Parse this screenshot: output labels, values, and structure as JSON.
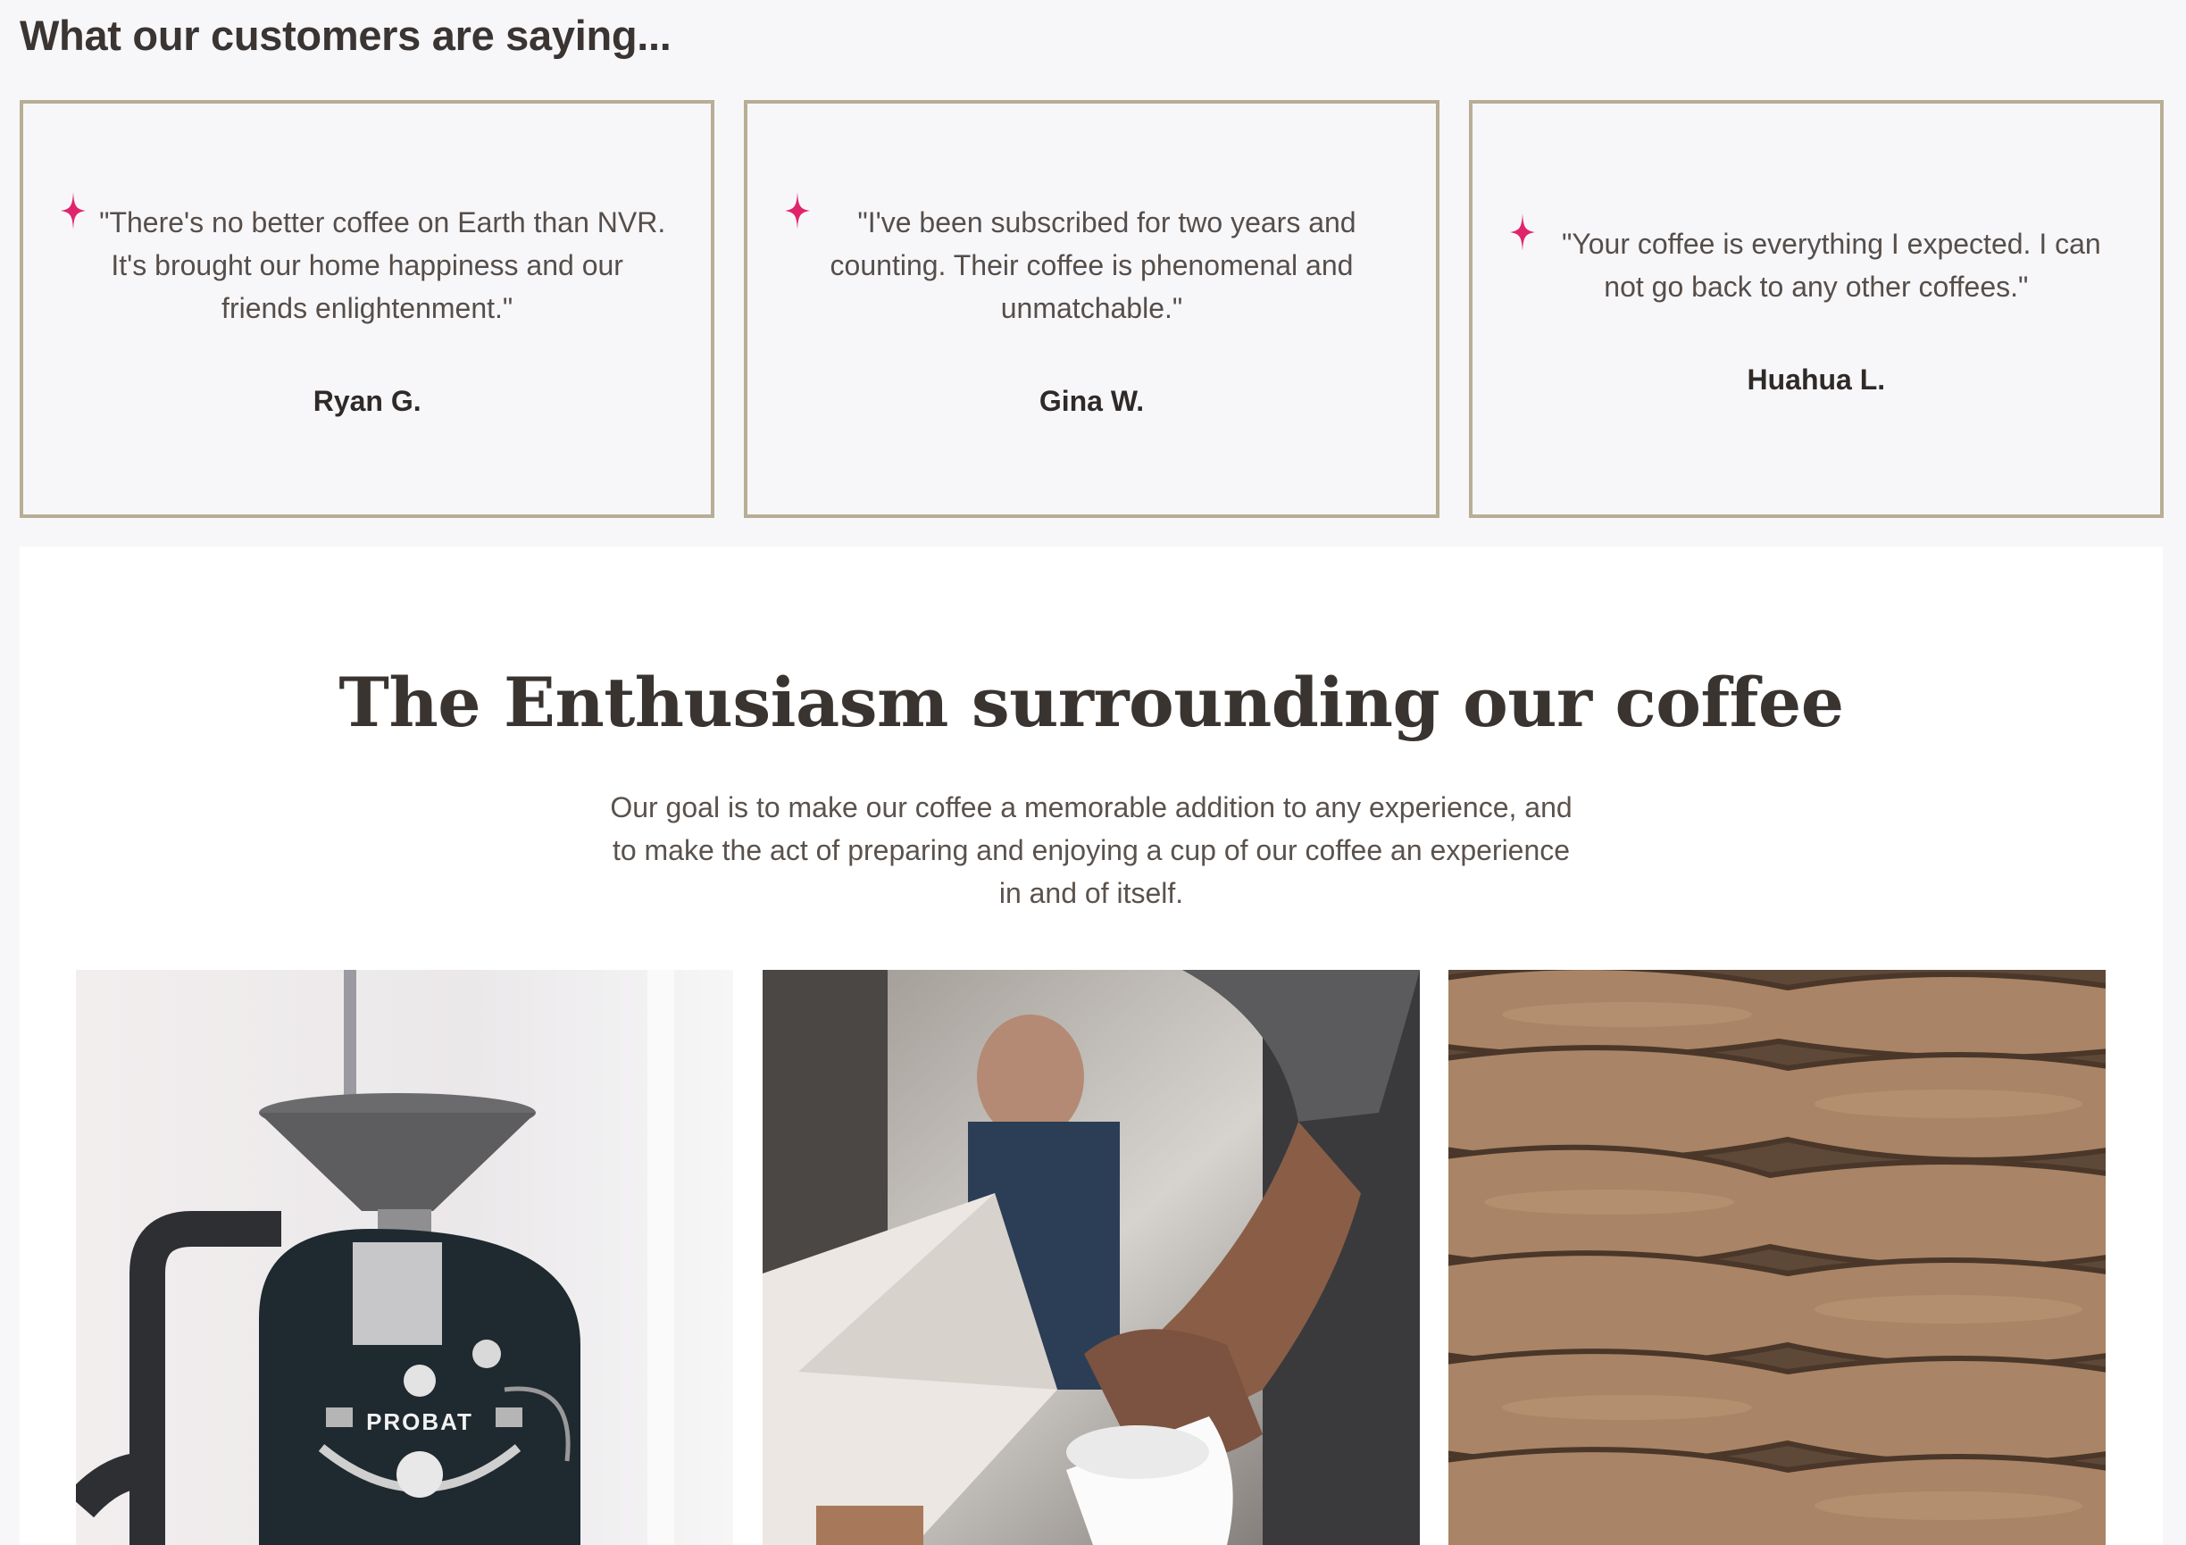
{
  "testimonials": {
    "heading": "What our customers are saying...",
    "items": [
      {
        "quote": "\"There's no better coffee on Earth than NVR. It's brought our home happiness and our friends enlightenment.\"",
        "author": "Ryan G."
      },
      {
        "quote": "\"I've been subscribed for two years and counting. Their coffee is phenomenal and unmatchable.\"",
        "author": "Gina W."
      },
      {
        "quote": "\"Your coffee is everything I expected. I can not go back to any other coffees.\"",
        "author": "Huahua L."
      }
    ],
    "accent_color": "#e0246c",
    "border_color": "#b8ad95"
  },
  "feature": {
    "title": "The Enthusiasm surrounding our coffee",
    "description": "Our goal is to make our coffee a memorable addition to any experience, and to make the act of preparing and enjoying a cup of our coffee an experience in and of itself.",
    "images": [
      {
        "name": "coffee-roaster-photo",
        "label": "PROBAT"
      },
      {
        "name": "pour-over-photo"
      },
      {
        "name": "coffee-sacks-photo"
      }
    ]
  }
}
